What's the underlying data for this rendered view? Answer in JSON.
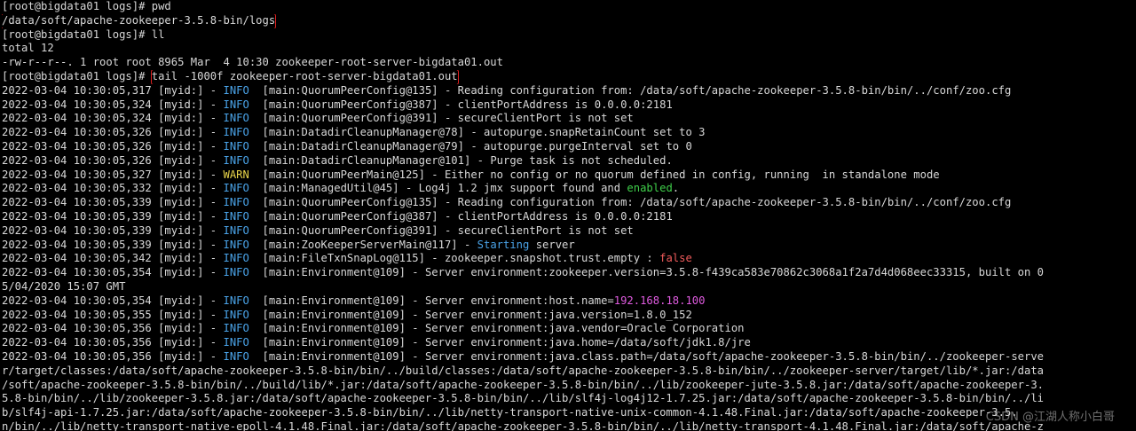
{
  "colors": {
    "background": "#000000",
    "text": "#d8d8d8",
    "info": "#4aa3e8",
    "warn": "#e8d44a",
    "enabled": "#3fcf4a",
    "false": "#ef5b5b",
    "ip": "#e05be0",
    "highlight_box": "#e02020"
  },
  "terminal": {
    "lines": [
      {
        "id": "l1",
        "segs": [
          {
            "t": "[root@bigdata01 logs]# pwd",
            "c": "white"
          }
        ]
      },
      {
        "id": "l2",
        "highlight": true,
        "segs": [
          {
            "t": "/data/soft/apache-zookeeper-3.5.8-bin/logs",
            "c": "white"
          }
        ]
      },
      {
        "id": "l3",
        "segs": [
          {
            "t": "[root@bigdata01 logs]# ll",
            "c": "white"
          }
        ]
      },
      {
        "id": "l4",
        "segs": [
          {
            "t": "total 12",
            "c": "white"
          }
        ]
      },
      {
        "id": "l5",
        "segs": [
          {
            "t": "-rw-r--r--. 1 root root 8965 Mar  4 10:30 zookeeper-root-server-bigdata01.out",
            "c": "white"
          }
        ]
      },
      {
        "id": "l6",
        "segs": [
          {
            "t": "[root@bigdata01 logs]# ",
            "c": "white"
          },
          {
            "t": "tail -1000f zookeeper-root-server-bigdata01.out",
            "c": "white",
            "hl": true
          }
        ]
      },
      {
        "id": "l7",
        "segs": [
          {
            "t": "2022-03-04 10:30:05,317 [myid:] - ",
            "c": "white"
          },
          {
            "t": "INFO",
            "c": "blue"
          },
          {
            "t": "  [main:QuorumPeerConfig@135] - Reading configuration from: /data/soft/apache-zookeeper-3.5.8-bin/bin/../conf/zoo.cfg",
            "c": "white"
          }
        ]
      },
      {
        "id": "l8",
        "segs": [
          {
            "t": "2022-03-04 10:30:05,324 [myid:] - ",
            "c": "white"
          },
          {
            "t": "INFO",
            "c": "blue"
          },
          {
            "t": "  [main:QuorumPeerConfig@387] - clientPortAddress is 0.0.0.0:2181",
            "c": "white"
          }
        ]
      },
      {
        "id": "l9",
        "segs": [
          {
            "t": "2022-03-04 10:30:05,324 [myid:] - ",
            "c": "white"
          },
          {
            "t": "INFO",
            "c": "blue"
          },
          {
            "t": "  [main:QuorumPeerConfig@391] - secureClientPort is not set",
            "c": "white"
          }
        ]
      },
      {
        "id": "l10",
        "segs": [
          {
            "t": "2022-03-04 10:30:05,326 [myid:] - ",
            "c": "white"
          },
          {
            "t": "INFO",
            "c": "blue"
          },
          {
            "t": "  [main:DatadirCleanupManager@78] - autopurge.snapRetainCount set to 3",
            "c": "white"
          }
        ]
      },
      {
        "id": "l11",
        "segs": [
          {
            "t": "2022-03-04 10:30:05,326 [myid:] - ",
            "c": "white"
          },
          {
            "t": "INFO",
            "c": "blue"
          },
          {
            "t": "  [main:DatadirCleanupManager@79] - autopurge.purgeInterval set to 0",
            "c": "white"
          }
        ]
      },
      {
        "id": "l12",
        "segs": [
          {
            "t": "2022-03-04 10:30:05,326 [myid:] - ",
            "c": "white"
          },
          {
            "t": "INFO",
            "c": "blue"
          },
          {
            "t": "  [main:DatadirCleanupManager@101] - Purge task is not scheduled.",
            "c": "white"
          }
        ]
      },
      {
        "id": "l13",
        "segs": [
          {
            "t": "2022-03-04 10:30:05,327 [myid:] - ",
            "c": "white"
          },
          {
            "t": "WARN",
            "c": "yellow"
          },
          {
            "t": "  [main:QuorumPeerMain@125] - Either no config or no quorum defined in config, running  in standalone mode",
            "c": "white"
          }
        ]
      },
      {
        "id": "l14",
        "segs": [
          {
            "t": "2022-03-04 10:30:05,332 [myid:] - ",
            "c": "white"
          },
          {
            "t": "INFO",
            "c": "blue"
          },
          {
            "t": "  [main:ManagedUtil@45] - Log4j 1.2 jmx support found and ",
            "c": "white"
          },
          {
            "t": "enabled",
            "c": "green"
          },
          {
            "t": ".",
            "c": "white"
          }
        ]
      },
      {
        "id": "l15",
        "segs": [
          {
            "t": "2022-03-04 10:30:05,339 [myid:] - ",
            "c": "white"
          },
          {
            "t": "INFO",
            "c": "blue"
          },
          {
            "t": "  [main:QuorumPeerConfig@135] - Reading configuration from: /data/soft/apache-zookeeper-3.5.8-bin/bin/../conf/zoo.cfg",
            "c": "white"
          }
        ]
      },
      {
        "id": "l16",
        "segs": [
          {
            "t": "2022-03-04 10:30:05,339 [myid:] - ",
            "c": "white"
          },
          {
            "t": "INFO",
            "c": "blue"
          },
          {
            "t": "  [main:QuorumPeerConfig@387] - clientPortAddress is 0.0.0.0:2181",
            "c": "white"
          }
        ]
      },
      {
        "id": "l17",
        "segs": [
          {
            "t": "2022-03-04 10:30:05,339 [myid:] - ",
            "c": "white"
          },
          {
            "t": "INFO",
            "c": "blue"
          },
          {
            "t": "  [main:QuorumPeerConfig@391] - secureClientPort is not set",
            "c": "white"
          }
        ]
      },
      {
        "id": "l18",
        "segs": [
          {
            "t": "2022-03-04 10:30:05,339 [myid:] - ",
            "c": "white"
          },
          {
            "t": "INFO",
            "c": "blue"
          },
          {
            "t": "  [main:ZooKeeperServerMain@117] - ",
            "c": "white"
          },
          {
            "t": "Starting",
            "c": "blue"
          },
          {
            "t": " server",
            "c": "white"
          }
        ]
      },
      {
        "id": "l19",
        "segs": [
          {
            "t": "2022-03-04 10:30:05,342 [myid:] - ",
            "c": "white"
          },
          {
            "t": "INFO",
            "c": "blue"
          },
          {
            "t": "  [main:FileTxnSnapLog@115] - zookeeper.snapshot.trust.empty : ",
            "c": "white"
          },
          {
            "t": "false",
            "c": "red"
          }
        ]
      },
      {
        "id": "l20",
        "segs": [
          {
            "t": "2022-03-04 10:30:05,354 [myid:] - ",
            "c": "white"
          },
          {
            "t": "INFO",
            "c": "blue"
          },
          {
            "t": "  [main:Environment@109] - Server environment:zookeeper.version=3.5.8-f439ca583e70862c3068a1f2a7d4d068eec33315, built on 0",
            "c": "white"
          }
        ]
      },
      {
        "id": "l21",
        "segs": [
          {
            "t": "5/04/2020 15:07 GMT",
            "c": "white"
          }
        ]
      },
      {
        "id": "l22",
        "segs": [
          {
            "t": "2022-03-04 10:30:05,354 [myid:] - ",
            "c": "white"
          },
          {
            "t": "INFO",
            "c": "blue"
          },
          {
            "t": "  [main:Environment@109] - Server environment:host.name=",
            "c": "white"
          },
          {
            "t": "192.168.18.100",
            "c": "magenta"
          }
        ]
      },
      {
        "id": "l23",
        "segs": [
          {
            "t": "2022-03-04 10:30:05,355 [myid:] - ",
            "c": "white"
          },
          {
            "t": "INFO",
            "c": "blue"
          },
          {
            "t": "  [main:Environment@109] - Server environment:java.version=1.8.0_152",
            "c": "white"
          }
        ]
      },
      {
        "id": "l24",
        "segs": [
          {
            "t": "2022-03-04 10:30:05,356 [myid:] - ",
            "c": "white"
          },
          {
            "t": "INFO",
            "c": "blue"
          },
          {
            "t": "  [main:Environment@109] - Server environment:java.vendor=Oracle Corporation",
            "c": "white"
          }
        ]
      },
      {
        "id": "l25",
        "segs": [
          {
            "t": "2022-03-04 10:30:05,356 [myid:] - ",
            "c": "white"
          },
          {
            "t": "INFO",
            "c": "blue"
          },
          {
            "t": "  [main:Environment@109] - Server environment:java.home=/data/soft/jdk1.8/jre",
            "c": "white"
          }
        ]
      },
      {
        "id": "l26",
        "segs": [
          {
            "t": "2022-03-04 10:30:05,356 [myid:] - ",
            "c": "white"
          },
          {
            "t": "INFO",
            "c": "blue"
          },
          {
            "t": "  [main:Environment@109] - Server environment:java.class.path=/data/soft/apache-zookeeper-3.5.8-bin/bin/../zookeeper-serve",
            "c": "white"
          }
        ]
      },
      {
        "id": "l27",
        "segs": [
          {
            "t": "r/target/classes:/data/soft/apache-zookeeper-3.5.8-bin/bin/../build/classes:/data/soft/apache-zookeeper-3.5.8-bin/bin/../zookeeper-server/target/lib/*.jar:/data",
            "c": "white"
          }
        ]
      },
      {
        "id": "l28",
        "segs": [
          {
            "t": "/soft/apache-zookeeper-3.5.8-bin/bin/../build/lib/*.jar:/data/soft/apache-zookeeper-3.5.8-bin/bin/../lib/zookeeper-jute-3.5.8.jar:/data/soft/apache-zookeeper-3.",
            "c": "white"
          }
        ]
      },
      {
        "id": "l29",
        "segs": [
          {
            "t": "5.8-bin/bin/../lib/zookeeper-3.5.8.jar:/data/soft/apache-zookeeper-3.5.8-bin/bin/../lib/slf4j-log4j12-1.7.25.jar:/data/soft/apache-zookeeper-3.5.8-bin/bin/../li",
            "c": "white"
          }
        ]
      },
      {
        "id": "l30",
        "segs": [
          {
            "t": "b/slf4j-api-1.7.25.jar:/data/soft/apache-zookeeper-3.5.8-bin/bin/../lib/netty-transport-native-unix-common-4.1.48.Final.jar:/data/soft/apache-zookeeper-3.5.",
            "c": "white"
          }
        ]
      },
      {
        "id": "l31",
        "segs": [
          {
            "t": "n/bin/../lib/netty-transport-native-epoll-4.1.48.Final.jar:/data/soft/apache-zookeeper-3.5.8-bin/bin/../lib/netty-transport-4.1.48.Final.jar:/data/soft/apache-z",
            "c": "white"
          }
        ]
      }
    ]
  },
  "watermark": {
    "text": "CSDN @江湖人称小白哥"
  }
}
